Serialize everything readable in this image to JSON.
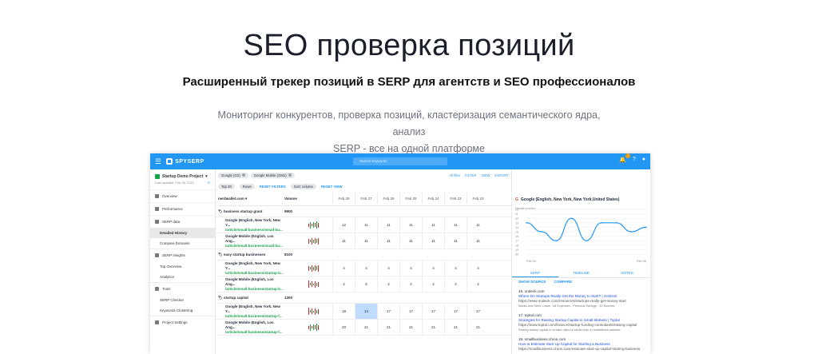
{
  "hero": {
    "title": "SEO проверка позиций",
    "subtitle": "Расширенный трекер позиций в SERP для агентств и SEO профессионалов",
    "desc1": "Мониторинг конкурентов, проверка позиций, кластеризация семантического ядра, анализ",
    "desc2": "SERP - все на одной платформе"
  },
  "app": {
    "logo": "SPYSERP",
    "search_placeholder": "Search keywords",
    "sidebar": {
      "project": "Startup Demo Project",
      "last_updated": "Last updated: Feb 28, 2022",
      "items": [
        {
          "label": "Overview",
          "type": "section"
        },
        {
          "label": "Performance",
          "type": "section"
        },
        {
          "label": "SERP data",
          "type": "section"
        },
        {
          "label": "Detailed History",
          "type": "item",
          "active": true
        },
        {
          "label": "Compare Domains",
          "type": "item"
        },
        {
          "label": "SERP Insights",
          "type": "section"
        },
        {
          "label": "Top Overview",
          "type": "item"
        },
        {
          "label": "Analytics",
          "type": "item"
        },
        {
          "label": "Tools",
          "type": "section"
        },
        {
          "label": "SERP Checker",
          "type": "item"
        },
        {
          "label": "Keywords Clustering",
          "type": "item"
        },
        {
          "label": "Project Settings",
          "type": "section"
        }
      ]
    },
    "chips": [
      "Google (G2)",
      "Google Mobile (GM1)"
    ],
    "toolbar": {
      "all_files": "All files",
      "filter": "FILTER",
      "view": "VIEW",
      "export": "EXPORT"
    },
    "filters": {
      "top": "Top 20",
      "rows": "Rows",
      "reset_filters": "RESET FILTERS",
      "sort": "Sort: volume",
      "reset_view": "RESET VIEW"
    },
    "table": {
      "domain": "nerdwallet.com",
      "volume_header": "Volume",
      "dates": [
        "Feb 28",
        "Feb 27",
        "Feb 26",
        "Feb 25",
        "Feb 24",
        "Feb 23",
        "Feb 22"
      ],
      "groups": [
        {
          "keyword": "business startup grant",
          "volume": "9900",
          "rows": [
            {
              "engine": "Google (English, New York, New Y...",
              "url": "/article/small-business/small-bu...",
              "values": [
                "12",
                "11",
                "11",
                "11",
                "11",
                "11",
                "11"
              ]
            },
            {
              "engine": "Google Mobile (English, Los Ang...",
              "url": "/article/small-business/small-bu...",
              "values": [
                "11",
                "11",
                "11",
                "11",
                "11",
                "11",
                "11"
              ]
            }
          ]
        },
        {
          "keyword": "easy startup businesses",
          "volume": "8100",
          "rows": [
            {
              "engine": "Google (English, New York, New Y...",
              "url": "/article/small-business/startup-b...",
              "values": [
                "4",
                "4",
                "4",
                "4",
                "4",
                "4",
                "4"
              ]
            },
            {
              "engine": "Google Mobile (English, Los Ang...",
              "url": "/article/small-business/startup-b...",
              "values": [
                "4",
                "5",
                "4",
                "4",
                "4",
                "4",
                "4"
              ]
            }
          ]
        },
        {
          "keyword": "startup capital",
          "volume": "1300",
          "rows": [
            {
              "engine": "Google (English, New York, New Y...",
              "url": "/article/small-business/startup-f...",
              "values": [
                "18",
                "14",
                "17",
                "17",
                "17",
                "17",
                "17"
              ]
            },
            {
              "engine": "Google Mobile (English, Los Ang...",
              "url": "/article/small-business/startup-f...",
              "values": [
                "20",
                "21",
                "21",
                "21",
                "21",
                "21",
                "21"
              ]
            }
          ]
        }
      ]
    },
    "panel": {
      "title": "Google (English, New York, New York,United States)",
      "chart_label": "Domain position",
      "yticks": [
        "10",
        "11",
        "12",
        "13",
        "14",
        "15",
        "16",
        "17",
        "18",
        "19",
        "20"
      ],
      "x_start": "Feb 20",
      "x_end": "Feb 28",
      "tabs": [
        "SERP",
        "TIMELINE",
        "NOTES"
      ],
      "show_source": "SHOW SOURCE",
      "compare": "COMPARE",
      "results": [
        {
          "rank": "16.",
          "domain": "ondeck.com",
          "title": "Where Do Startups Really Get the Money to Start? | OnDeck",
          "url": "https://www.ondeck.com/resources/startups-really-get-money-start",
          "meta": "Banks and Other Loans · All Expenses · Personal Savings · 20 Sources"
        },
        {
          "rank": "17.",
          "domain": "toptal.com",
          "title": "Strategies for Raising Startup Capital in Small Markets | Toptal",
          "url": "https://www.toptal.com/finance/startup-funding-consultants/raising-capital",
          "meta": "Raising startup capital in smaller cities is harder than in established markets"
        },
        {
          "rank": "18.",
          "domain": "smallbusiness.chron.com",
          "title": "How to Estimate Start Up Capital for Starting a Business",
          "url": "https://smallbusiness.chron.com/estimate-start-up-capital-starting-business",
          "meta": ""
        }
      ]
    }
  },
  "chart_data": {
    "type": "line",
    "title": "Domain position",
    "x": [
      "Feb 20",
      "Feb 21",
      "Feb 22",
      "Feb 23",
      "Feb 24",
      "Feb 25",
      "Feb 26",
      "Feb 27",
      "Feb 28"
    ],
    "series": [
      {
        "values": [
          13,
          15,
          17,
          12,
          17,
          13,
          13,
          15,
          14
        ]
      }
    ],
    "ylim": [
      20,
      10
    ],
    "colors": {
      "line": "#2196f3"
    }
  }
}
